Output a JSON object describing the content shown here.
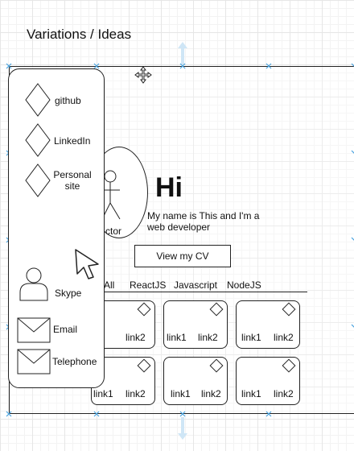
{
  "page_title": "Variations / Ideas",
  "sidebar": {
    "items": [
      {
        "label": "github",
        "icon": "diamond-icon"
      },
      {
        "label": "LinkedIn",
        "icon": "diamond-icon"
      },
      {
        "label": "Personal site",
        "icon": "diamond-icon"
      },
      {
        "label": "Skype",
        "icon": "user-icon"
      },
      {
        "label": "Email",
        "icon": "envelope-icon"
      },
      {
        "label": "Telephone",
        "icon": "envelope-icon"
      }
    ]
  },
  "hero": {
    "actor_label": "ctor",
    "greeting": "Hi",
    "intro": "My name is This and I'm a web developer",
    "cv_button": "View my CV"
  },
  "tabs": [
    "All",
    "ReactJS",
    "Javascript",
    "NodeJS"
  ],
  "cards": [
    {
      "link1": "",
      "link2": "link2"
    },
    {
      "link1": "link1",
      "link2": "link2"
    },
    {
      "link1": "link1",
      "link2": "link2"
    },
    {
      "link1": "link1",
      "link2": "link2"
    },
    {
      "link1": "link1",
      "link2": "link2"
    },
    {
      "link1": "link1",
      "link2": "link2"
    }
  ],
  "colors": {
    "handle": "#4aa3df",
    "stroke": "#222222"
  }
}
